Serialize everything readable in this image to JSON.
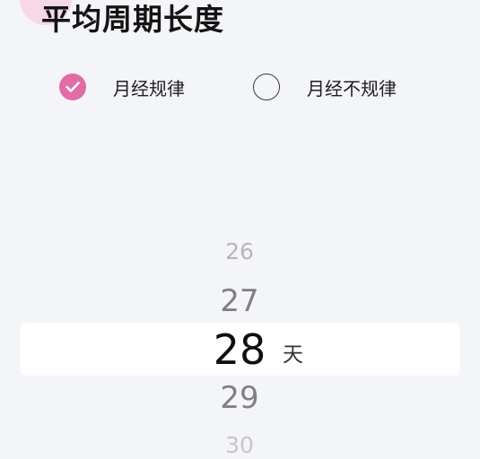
{
  "header": {
    "title": "平均周期长度"
  },
  "cycle_type": {
    "options": [
      {
        "label": "月经规律",
        "checked": true
      },
      {
        "label": "月经不规律",
        "checked": false
      }
    ]
  },
  "picker": {
    "values": [
      "26",
      "27",
      "28",
      "29",
      "30"
    ],
    "selected": "28",
    "unit": "天"
  },
  "colors": {
    "accent": "#e26ca6",
    "background": "#f4f5f9",
    "highlight": "#ffffff"
  }
}
